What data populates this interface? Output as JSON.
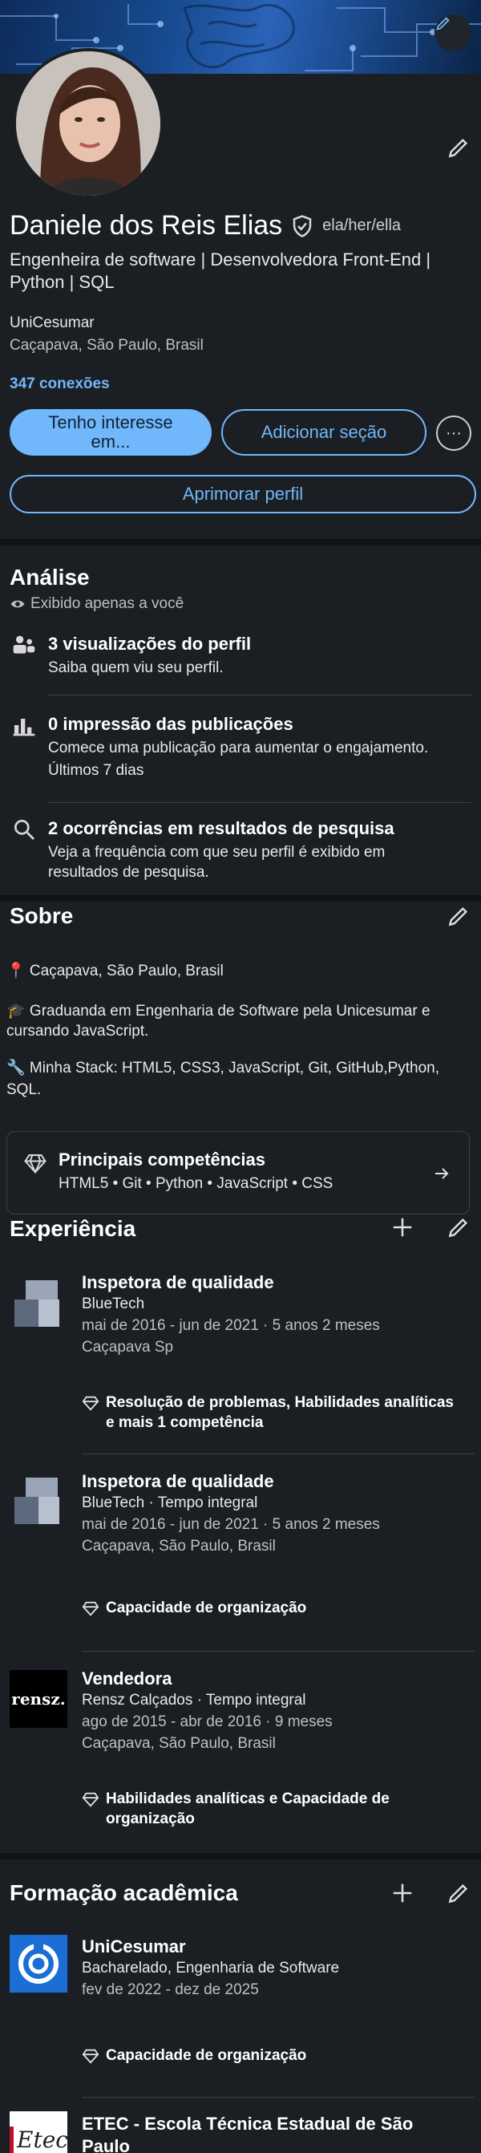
{
  "profile": {
    "name": "Daniele dos Reis Elias",
    "pronouns": "ela/her/ella",
    "headline": "Engenheira de software | Desenvolvedora Front-End | Python | SQL",
    "school": "UniCesumar",
    "location": "Caçapava, São Paulo, Brasil",
    "connections": "347 conexões"
  },
  "actions": {
    "interest": "Tenho interesse em...",
    "add_section": "Adicionar seção",
    "more": "···",
    "improve": "Aprimorar perfil"
  },
  "analytics": {
    "title": "Análise",
    "visibility": "Exibido apenas a você",
    "items": [
      {
        "title": "3 visualizações do perfil",
        "desc": "Saiba quem viu seu perfil.",
        "extra": ""
      },
      {
        "title": "0 impressão das publicações",
        "desc": "Comece uma publicação para aumentar o engajamento.",
        "extra": "Últimos 7 dias"
      },
      {
        "title": "2 ocorrências em resultados de pesquisa",
        "desc": "Veja a frequência com que seu perfil é exibido em resultados de pesquisa.",
        "extra": ""
      }
    ]
  },
  "about": {
    "title": "Sobre",
    "line1": "📍 Caçapava, São Paulo, Brasil",
    "line2": "🎓 Graduanda em Engenharia de Software pela Unicesumar e cursando JavaScript.",
    "line3": "🔧 Minha Stack: HTML5, CSS3, JavaScript, Git, GitHub,Python, SQL.",
    "top_skills_title": "Principais competências",
    "top_skills": "HTML5 • Git • Python • JavaScript • CSS"
  },
  "experience": {
    "title": "Experiência",
    "items": [
      {
        "role": "Inspetora de qualidade",
        "company": "BlueTech",
        "dates": "mai de 2016 - jun de 2021 · 5 anos 2 meses",
        "place": "Caçapava Sp",
        "skills": "Resolução de problemas, Habilidades analíticas e mais 1 competência"
      },
      {
        "role": "Inspetora de qualidade",
        "company": "BlueTech  · Tempo integral",
        "dates": "mai de 2016 - jun de 2021 · 5 anos 2 meses",
        "place": "Caçapava, São Paulo, Brasil",
        "skills": "Capacidade de organização"
      },
      {
        "role": "Vendedora",
        "company": "Rensz Calçados · Tempo integral",
        "dates": "ago de 2015 - abr de 2016 · 9 meses",
        "place": "Caçapava, São Paulo, Brasil",
        "skills": "Habilidades analíticas e Capacidade de organização",
        "logo_text": "rensz."
      }
    ]
  },
  "education": {
    "title": "Formação acadêmica",
    "items": [
      {
        "school": "UniCesumar",
        "degree": "Bacharelado, Engenharia de Software",
        "dates": "fev de 2022 - dez de 2025",
        "skills": "Capacidade de organização"
      },
      {
        "school": "ETEC - Escola Técnica Estadual de São Paulo",
        "logo_text": "Etec"
      }
    ]
  },
  "colors": {
    "accent": "#71b7fb",
    "background": "#1b1f23",
    "divider": "#3b4046"
  }
}
